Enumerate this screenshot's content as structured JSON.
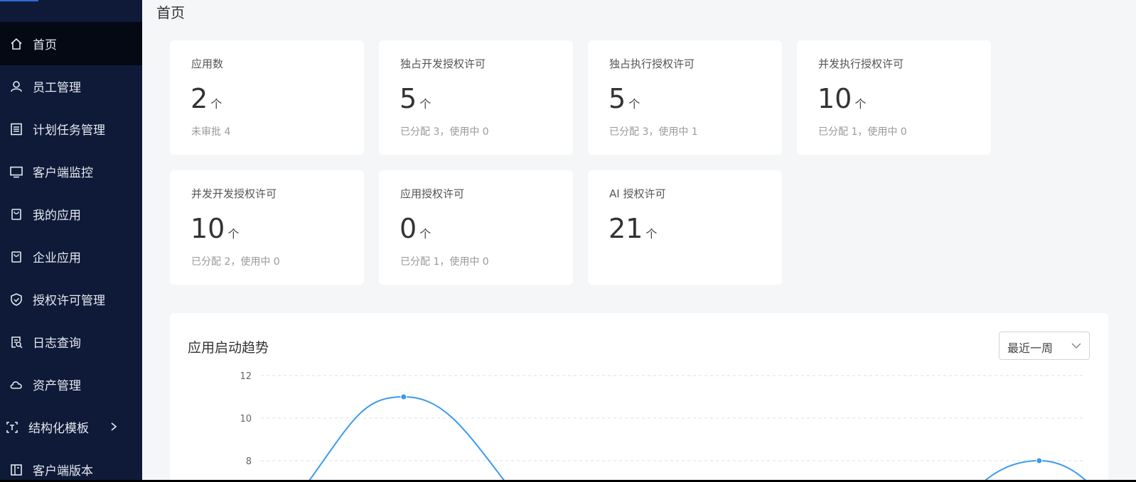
{
  "sidebar": {
    "items": [
      {
        "label": "首页",
        "icon": "home-icon",
        "active": true
      },
      {
        "label": "员工管理",
        "icon": "user-icon"
      },
      {
        "label": "计划任务管理",
        "icon": "task-list-icon"
      },
      {
        "label": "客户端监控",
        "icon": "monitor-icon"
      },
      {
        "label": "我的应用",
        "icon": "app-bag-icon"
      },
      {
        "label": "企业应用",
        "icon": "enterprise-app-icon"
      },
      {
        "label": "授权许可管理",
        "icon": "shield-check-icon"
      },
      {
        "label": "日志查询",
        "icon": "log-search-icon"
      },
      {
        "label": "资产管理",
        "icon": "cloud-icon"
      },
      {
        "label": "结构化模板",
        "icon": "template-scan-icon",
        "has_submenu": true
      },
      {
        "label": "客户端版本",
        "icon": "version-book-icon"
      }
    ]
  },
  "page": {
    "title": "首页"
  },
  "stats": [
    {
      "label": "应用数",
      "value": "2",
      "unit": "个",
      "sub": "未审批 4"
    },
    {
      "label": "独占开发授权许可",
      "value": "5",
      "unit": "个",
      "sub": "已分配 3，使用中 0"
    },
    {
      "label": "独占执行授权许可",
      "value": "5",
      "unit": "个",
      "sub": "已分配 3，使用中 1"
    },
    {
      "label": "并发执行授权许可",
      "value": "10",
      "unit": "个",
      "sub": "已分配 1，使用中 0"
    },
    {
      "label": "并发开发授权许可",
      "value": "10",
      "unit": "个",
      "sub": "已分配 2，使用中 0"
    },
    {
      "label": "应用授权许可",
      "value": "0",
      "unit": "个",
      "sub": "已分配 1，使用中 0"
    },
    {
      "label": "AI 授权许可",
      "value": "21",
      "unit": "个",
      "sub": ""
    }
  ],
  "chart_section": {
    "title": "应用启动趋势",
    "range_select": {
      "selected": "最近一周"
    }
  },
  "chart_data": {
    "type": "line",
    "title": "应用启动趋势",
    "y_ticks": [
      8,
      10,
      12
    ],
    "ylim_visible": [
      8,
      12
    ],
    "smooth": true,
    "grid": true,
    "line_color": "#3a9af0",
    "series": [
      {
        "visible_points": [
          {
            "index": 1,
            "value": 11
          },
          {
            "index": 3,
            "value": 8
          }
        ]
      }
    ]
  },
  "colors": {
    "sidebar_bg": "#0e1a38",
    "sidebar_active": "#040914",
    "accent_line": "#3a9af0",
    "page_bg": "#f5f6f8"
  }
}
